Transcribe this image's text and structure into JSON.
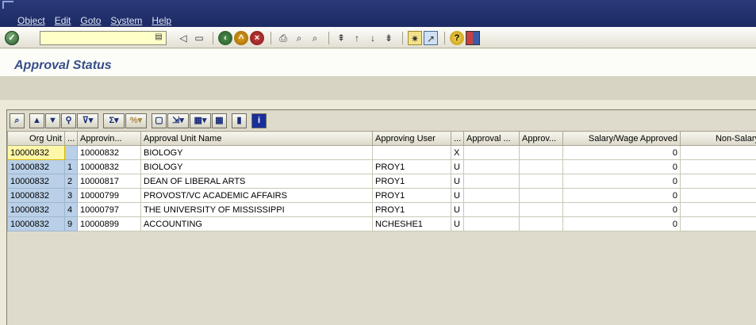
{
  "menubar": {
    "items": [
      "Object",
      "Edit",
      "Goto",
      "System",
      "Help"
    ]
  },
  "toolbar": {
    "command_value": "",
    "icons": [
      "enter-icon",
      "back-icon",
      "exit-icon",
      "cancel-icon",
      "print-icon",
      "find-icon",
      "find-next-icon",
      "first-page-icon",
      "previous-page-icon",
      "next-page-icon",
      "last-page-icon",
      "new-session-icon",
      "shortcut-icon",
      "help-icon",
      "layout-icon"
    ]
  },
  "title": "Approval Status",
  "alv": {
    "toolbar_icons": [
      "details-icon",
      "sort-ascending-icon",
      "sort-descending-icon",
      "find-icon",
      "filter-icon",
      "sum-icon",
      "subtotal-icon",
      "print-preview-icon",
      "export-icon",
      "spreadsheet-icon",
      "layout-icon",
      "graphic-icon",
      "info-icon"
    ],
    "columns": [
      "Org Unit",
      "...",
      "Approvin...",
      "Approval Unit Name",
      "Approving User",
      "...",
      "Approval ...",
      "Approv...",
      "Salary/Wage Approved",
      "Non-Salary"
    ],
    "rows": [
      [
        "10000832",
        "",
        "10000832",
        "BIOLOGY",
        "",
        "X",
        "",
        "",
        "0",
        ""
      ],
      [
        "10000832",
        "1",
        "10000832",
        "BIOLOGY",
        "PROY1",
        "U",
        "",
        "",
        "0",
        ""
      ],
      [
        "10000832",
        "2",
        "10000817",
        "DEAN OF LIBERAL ARTS",
        "PROY1",
        "U",
        "",
        "",
        "0",
        ""
      ],
      [
        "10000832",
        "3",
        "10000799",
        "PROVOST/VC ACADEMIC AFFAIRS",
        "PROY1",
        "U",
        "",
        "",
        "0",
        ""
      ],
      [
        "10000832",
        "4",
        "10000797",
        "THE UNIVERSITY OF MISSISSIPPI",
        "PROY1",
        "U",
        "",
        "",
        "0",
        ""
      ],
      [
        "10000832",
        "9",
        "10000899",
        "ACCOUNTING",
        "NCHESHE1",
        "U",
        "",
        "",
        "0",
        ""
      ]
    ]
  }
}
